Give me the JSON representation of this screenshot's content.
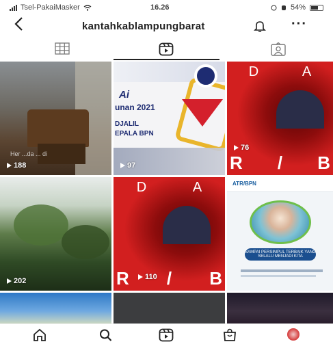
{
  "status_bar": {
    "carrier": "Tsel-PakaiMasker",
    "time": "16.26",
    "battery": "54%"
  },
  "header": {
    "back_icon": "chevron-left-icon",
    "username": "kantahkablampungbarat",
    "bell_icon": "bell-icon",
    "more_icon": "more-icon",
    "more_label": "···"
  },
  "tabs": [
    {
      "name": "grid",
      "icon": "grid-icon",
      "selected": false
    },
    {
      "name": "reels",
      "icon": "reels-icon",
      "selected": true
    },
    {
      "name": "tagged",
      "icon": "tagged-icon",
      "selected": false
    }
  ],
  "reels": [
    {
      "views": "188",
      "caption": "Her ...da ... di",
      "kind": "room"
    },
    {
      "views": "97",
      "kind": "event",
      "text": {
        "title": "Ai",
        "line1": "unan 2021",
        "line2": "DJALIL",
        "line3": "EPALA BPN"
      }
    },
    {
      "views": "76",
      "kind": "red",
      "letters_top": [
        "D",
        "A"
      ],
      "letters_bottom": [
        "R",
        "/",
        "B"
      ]
    },
    {
      "views": "202",
      "kind": "tree"
    },
    {
      "views": "110",
      "kind": "red",
      "letters_top": [
        "D",
        "A"
      ],
      "letters_bottom": [
        "R",
        "/",
        "B"
      ]
    },
    {
      "views": "",
      "kind": "promo",
      "text": {
        "logo": "ATR/BPN",
        "banner": "SAMPAI PERSIMPUL TERBAIK YANG SELALU MENJADI KITA"
      }
    },
    {
      "views": "",
      "kind": "sky"
    },
    {
      "views": "",
      "kind": "dark"
    },
    {
      "views": "",
      "kind": "night"
    }
  ],
  "bottom_nav": [
    {
      "name": "home",
      "icon": "home-icon"
    },
    {
      "name": "search",
      "icon": "search-icon"
    },
    {
      "name": "reels",
      "icon": "reels-icon"
    },
    {
      "name": "shop",
      "icon": "shop-icon"
    },
    {
      "name": "profile",
      "icon": "avatar"
    }
  ],
  "colors": {
    "accent": "#222222",
    "red_tile": "#d21f1f"
  }
}
